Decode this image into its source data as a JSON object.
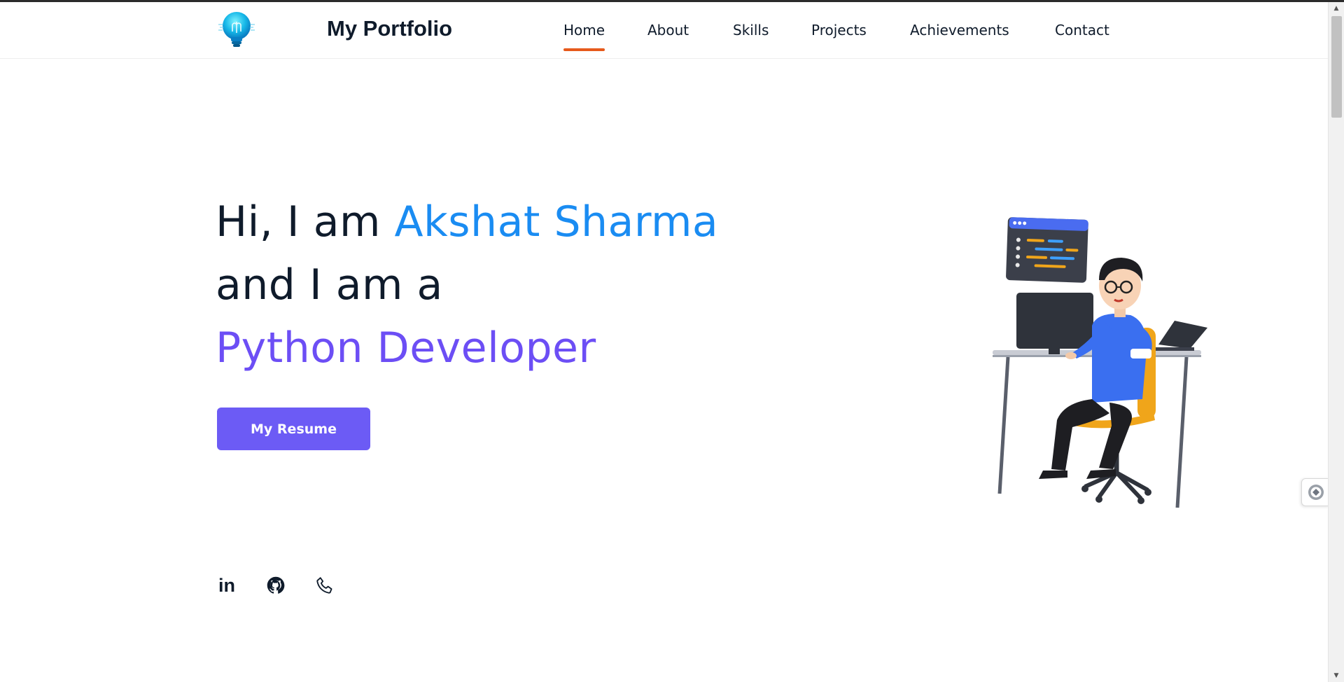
{
  "header": {
    "brand": "My Portfolio",
    "nav": [
      {
        "label": "Home",
        "active": true
      },
      {
        "label": "About",
        "active": false
      },
      {
        "label": "Skills",
        "active": false
      },
      {
        "label": "Projects",
        "active": false
      },
      {
        "label": "Achievements",
        "active": false
      },
      {
        "label": "Contact",
        "active": false
      }
    ]
  },
  "hero": {
    "greeting": "Hi, I am ",
    "name": "Akshat Sharma",
    "line2": "and I am a",
    "role": "Python Developer",
    "resume_button": "My Resume"
  },
  "social": {
    "linkedin_text": "in",
    "icons": [
      "linkedin-icon",
      "github-icon",
      "phone-icon"
    ]
  },
  "colors": {
    "name_blue": "#1a8cf2",
    "role_purple": "#6c4ef5",
    "button": "#6c5bf5",
    "nav_active_underline": "#e65a1c",
    "text_dark": "#0f1b2b"
  }
}
